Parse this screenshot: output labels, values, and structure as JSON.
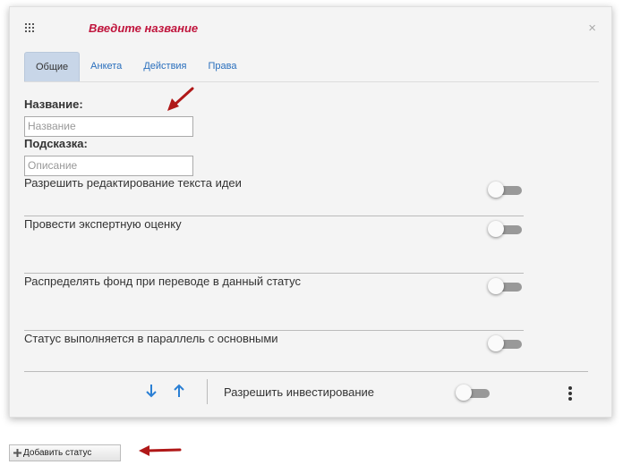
{
  "dialog": {
    "title_placeholder": "Введите название",
    "close_glyph": "×",
    "tabs": [
      {
        "label": "Общие",
        "active": true
      },
      {
        "label": "Анкета",
        "active": false
      },
      {
        "label": "Действия",
        "active": false
      },
      {
        "label": "Права",
        "active": false
      }
    ],
    "fields": {
      "name_label": "Название:",
      "name_placeholder": "Название",
      "hint_label": "Подсказка:",
      "hint_placeholder": "Описание"
    },
    "settings": [
      {
        "label": "Разрешить редактирование текста идеи",
        "enabled": false
      },
      {
        "label": "Провести экспертную оценку",
        "enabled": false
      },
      {
        "label": "Распределять фонд при переводе в данный статус",
        "enabled": false
      },
      {
        "label": "Статус выполняется в параллель с основными",
        "enabled": false
      }
    ],
    "footer": {
      "invest_label": "Разрешить инвестирование",
      "invest_enabled": false
    }
  },
  "add_status_button": "Добавить статус",
  "icons": {
    "grid": "grid-icon",
    "close": "close-icon",
    "move_down": "arrow-down-icon",
    "move_up": "arrow-up-icon",
    "more": "more-vertical-icon",
    "plus": "plus-icon",
    "annotation": "red-arrow-icon"
  },
  "colors": {
    "title": "#c0143c",
    "tab_link": "#2a6fbd",
    "active_tab_bg": "#c8d6e8",
    "arrows": "#2a7fd4",
    "annotation": "#b01818"
  }
}
